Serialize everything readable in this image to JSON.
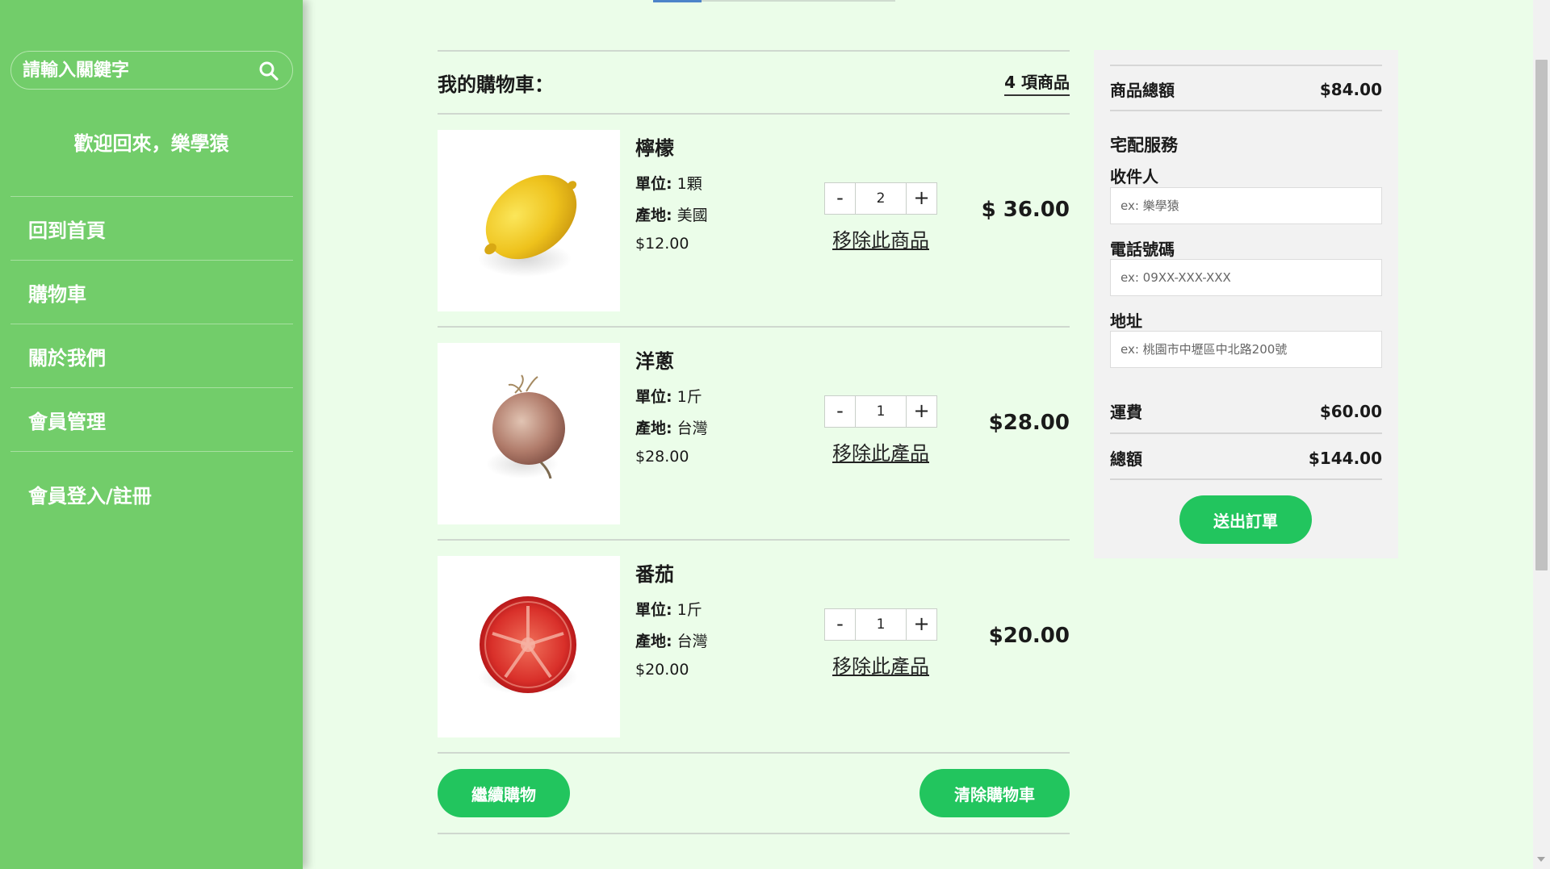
{
  "sidebar": {
    "search_placeholder": "請輸入關鍵字",
    "welcome": "歡迎回來，樂學猿",
    "nav": [
      "回到首頁",
      "購物車",
      "關於我們",
      "會員管理",
      "會員登入/註冊"
    ]
  },
  "cart": {
    "title": "我的購物車：",
    "count_label": "4 項商品",
    "unit_label": "單位:",
    "origin_label": "產地:",
    "items": [
      {
        "name": "檸檬",
        "unit": "1顆",
        "origin": "美國",
        "price": "$12.00",
        "qty": "2",
        "remove": "移除此商品",
        "total": "$ 36.00"
      },
      {
        "name": "洋蔥",
        "unit": "1斤",
        "origin": "台灣",
        "price": "$28.00",
        "qty": "1",
        "remove": "移除此產品",
        "total": "$28.00"
      },
      {
        "name": "番茄",
        "unit": "1斤",
        "origin": "台灣",
        "price": "$20.00",
        "qty": "1",
        "remove": "移除此產品",
        "total": "$20.00"
      }
    ],
    "continue_label": "繼續購物",
    "clear_label": "清除購物車"
  },
  "summary": {
    "subtotal_label": "商品總額",
    "subtotal_value": "$84.00",
    "delivery_title": "宅配服務",
    "recipient_label": "收件人",
    "recipient_placeholder": "ex: 樂學猿",
    "phone_label": "電話號碼",
    "phone_placeholder": "ex: 09XX-XXX-XXX",
    "address_label": "地址",
    "address_placeholder": "ex: 桃園市中壢區中北路200號",
    "shipping_label": "運費",
    "shipping_value": "$60.00",
    "total_label": "總額",
    "total_value": "$144.00",
    "submit_label": "送出訂單"
  },
  "colors": {
    "sidebar_bg": "#72cd6a",
    "page_bg": "#ebfde9",
    "button_green": "#22c55e",
    "summary_bg": "#f2f2f2"
  }
}
